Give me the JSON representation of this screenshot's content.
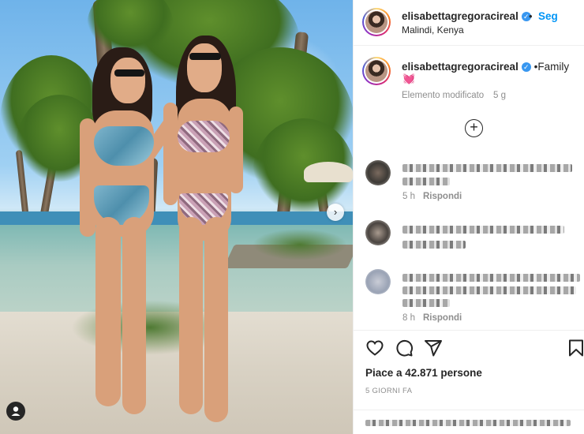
{
  "post": {
    "username": "elisabettagregoracireal",
    "follow_label": "Seg",
    "location": "Malindi, Kenya",
    "separator": "•"
  },
  "caption": {
    "username": "elisabettagregoracireal",
    "text": "•Family",
    "emoji": "💓",
    "edited": "Elemento modificato",
    "age": "5 g"
  },
  "comments": [
    {
      "time": "5 h",
      "reply_label": "Rispondi"
    },
    {
      "time": "",
      "reply_label": ""
    },
    {
      "time": "8 h",
      "reply_label": "Rispondi"
    }
  ],
  "actions": {
    "likes": "Piace a 42.871 persone",
    "date": "5 GIORNI FA"
  },
  "icons": {
    "verified": "verified-badge-icon",
    "load_more": "plus-circle-icon",
    "like": "heart-outline-icon",
    "comment": "speech-bubble-icon",
    "share": "paper-plane-icon",
    "save": "bookmark-icon",
    "carousel_next": "chevron-right-icon",
    "tags": "user-tag-icon"
  },
  "colors": {
    "link_blue": "#0095f6",
    "verified_blue": "#3897f0",
    "secondary_text": "#8e8e8e",
    "primary_text": "#262626"
  }
}
